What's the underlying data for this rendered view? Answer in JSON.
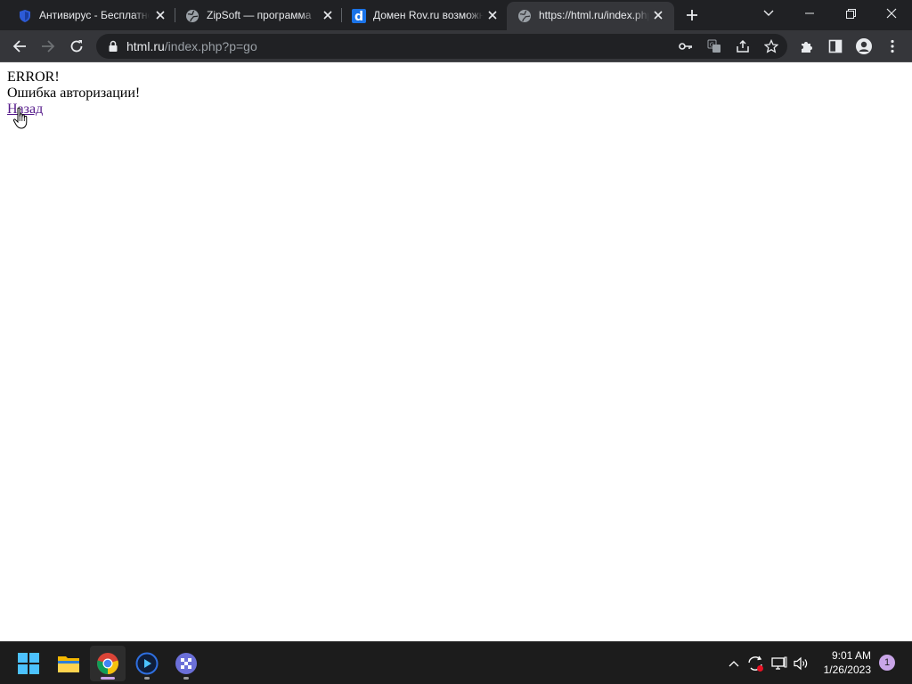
{
  "browser": {
    "tabs": [
      {
        "title": "Антивирус - Бесплатно",
        "favicon": "shield-icon",
        "active": false
      },
      {
        "title": "ZipSoft — программа",
        "favicon": "globe-icon",
        "active": false
      },
      {
        "title": "Домен Rov.ru возможно",
        "favicon": "d-logo-icon",
        "active": false
      },
      {
        "title": "https://html.ru/index.php",
        "favicon": "globe-icon",
        "active": true
      }
    ],
    "address": {
      "host": "html.ru",
      "rest": "/index.php?p=go"
    }
  },
  "page": {
    "line1": "ERROR!",
    "line2": "Ошибка авторизации!",
    "back_link": "Назад",
    "link_color": "#551a8b"
  },
  "taskbar": {
    "apps": [
      "windows-start-icon",
      "file-explorer-icon",
      "chrome-icon",
      "media-player-icon",
      "app-icon"
    ],
    "clock_time": "9:01 AM",
    "clock_date": "1/26/2023",
    "notification_count": "1"
  },
  "colors": {
    "tabstrip_bg": "#202124",
    "toolbar_bg": "#35363a",
    "taskbar_bg": "#1c1c1c",
    "accent": "#8ab4f8"
  }
}
